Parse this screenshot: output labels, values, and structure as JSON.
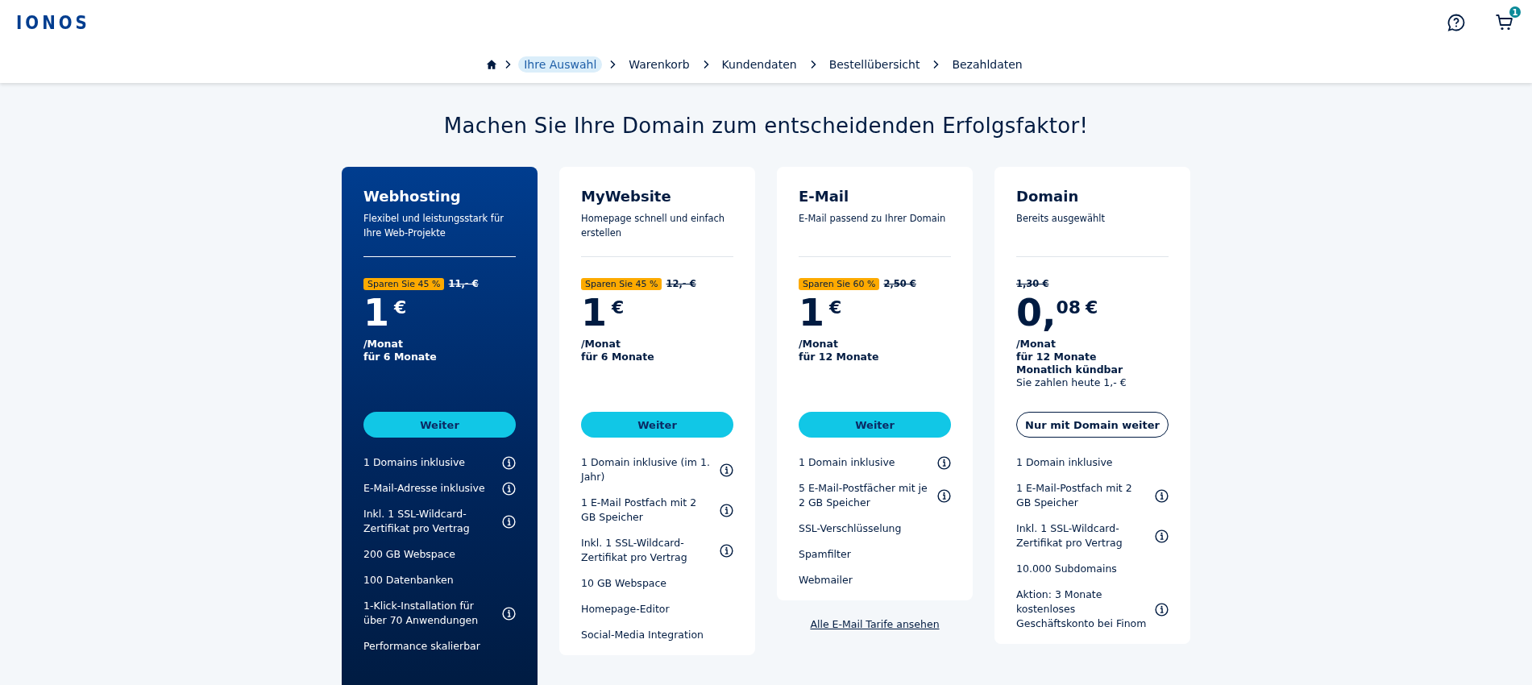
{
  "header": {
    "logo": "IONOS",
    "cart_count": "1"
  },
  "breadcrumb": [
    {
      "label": "Ihre Auswahl",
      "selected": true
    },
    {
      "label": "Warenkorb",
      "selected": false
    },
    {
      "label": "Kundendaten",
      "selected": false
    },
    {
      "label": "Bestellübersicht",
      "selected": false
    },
    {
      "label": "Bezahldaten",
      "selected": false
    }
  ],
  "headline": "Machen Sie Ihre Domain zum entscheidenden Erfolgsfaktor!",
  "plans": [
    {
      "title": "Webhosting",
      "subtitle": "Flexibel und leistungsstark für Ihre Web-Projekte",
      "highlighted": true,
      "badge": "Sparen Sie 45 %",
      "old_price": "11,- €",
      "amount": "1",
      "currency": "€",
      "terms": [
        {
          "text": "/Monat",
          "bold": true
        },
        {
          "text": "für 6 Monate",
          "bold": true
        }
      ],
      "button": {
        "label": "Weiter",
        "kind": "primary"
      },
      "features": [
        {
          "text": "1 Domains inklusive",
          "info": true
        },
        {
          "text": "E-Mail-Adresse inklusive",
          "info": true
        },
        {
          "text": "Inkl. 1 SSL-Wildcard-Zertifikat pro Vertrag",
          "info": true
        },
        {
          "text": "200 GB Webspace",
          "info": false
        },
        {
          "text": "100 Datenbanken",
          "info": false
        },
        {
          "text": "1-Klick-Installation für über 70 Anwendungen",
          "info": true
        },
        {
          "text": "Performance skalierbar",
          "info": false
        }
      ]
    },
    {
      "title": "MyWebsite",
      "subtitle": "Homepage schnell und einfach erstellen",
      "highlighted": false,
      "badge": "Sparen Sie 45 %",
      "old_price": "12,- €",
      "amount": "1",
      "currency": "€",
      "terms": [
        {
          "text": "/Monat",
          "bold": true
        },
        {
          "text": "für 6 Monate",
          "bold": true
        }
      ],
      "button": {
        "label": "Weiter",
        "kind": "primary"
      },
      "features": [
        {
          "text": "1 Domain inklusive (im 1. Jahr)",
          "info": true
        },
        {
          "text": "1 E-Mail Postfach mit 2 GB Speicher",
          "info": true
        },
        {
          "text": "Inkl. 1 SSL-Wildcard-Zertifikat pro Vertrag",
          "info": true
        },
        {
          "text": "10 GB Webspace",
          "info": false
        },
        {
          "text": "Homepage-Editor",
          "info": false
        },
        {
          "text": "Social-Media Integration",
          "info": false
        }
      ]
    },
    {
      "title": "E-Mail",
      "subtitle": "E-Mail passend zu Ihrer Domain",
      "highlighted": false,
      "badge": "Sparen Sie 60 %",
      "old_price": "2,50 €",
      "amount": "1",
      "currency": "€",
      "terms": [
        {
          "text": "/Monat",
          "bold": true
        },
        {
          "text": "für 12 Monate",
          "bold": true
        }
      ],
      "button": {
        "label": "Weiter",
        "kind": "primary"
      },
      "features": [
        {
          "text": "1 Domain inklusive",
          "info": true
        },
        {
          "text": "5 E-Mail-Postfächer mit je 2 GB Speicher",
          "info": true
        },
        {
          "text": "SSL-Verschlüsselung",
          "info": false
        },
        {
          "text": "Spamfilter",
          "info": false
        },
        {
          "text": "Webmailer",
          "info": false
        }
      ],
      "footer_link": "Alle E-Mail Tarife ansehen"
    },
    {
      "title": "Domain",
      "subtitle": "Bereits ausgewählt",
      "highlighted": false,
      "old_price": "1,30 €",
      "amount": "0,",
      "cents": "08",
      "currency": "€",
      "terms": [
        {
          "text": "/Monat",
          "bold": true
        },
        {
          "text": "für 12 Monate",
          "bold": true
        },
        {
          "text": "Monatlich kündbar",
          "bold": true
        },
        {
          "text": "Sie zahlen heute 1,- €",
          "bold": false
        }
      ],
      "button": {
        "label": "Nur mit Domain weiter",
        "kind": "outline"
      },
      "features": [
        {
          "text": "1 Domain inklusive",
          "info": false
        },
        {
          "text": "1 E-Mail-Postfach mit 2 GB Speicher",
          "info": true
        },
        {
          "text": "Inkl. 1 SSL-Wildcard-Zertifikat pro Vertrag",
          "info": true
        },
        {
          "text": "10.000 Subdomains",
          "info": false
        },
        {
          "text": "Aktion: 3 Monate kostenloses Geschäftskonto bei Finom",
          "info": true
        }
      ]
    }
  ]
}
